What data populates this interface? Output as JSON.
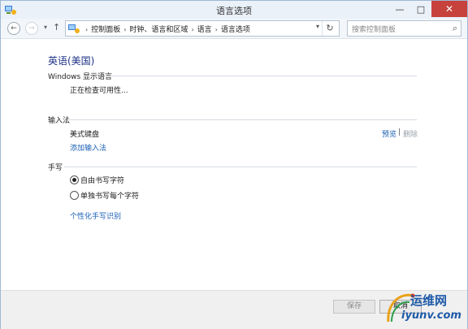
{
  "window": {
    "title": "语言选项",
    "minimize": "—",
    "maximize": "□",
    "close": "✕"
  },
  "nav": {
    "back": "←",
    "forward": "→",
    "history": "▾",
    "up": "↑",
    "breadcrumbs": [
      "控制面板",
      "时钟、语言和区域",
      "语言",
      "语言选项"
    ],
    "separator": "›",
    "dropdown": "▾",
    "refresh": "↻",
    "search_placeholder": "搜索控制面板",
    "search_icon": "⌕"
  },
  "content": {
    "language_title": "英语(美国)",
    "display_language": {
      "heading": "Windows 显示语言",
      "status": "正在检查可用性..."
    },
    "input_method": {
      "heading": "输入法",
      "items": [
        {
          "name": "美式键盘",
          "preview": "预览",
          "divider": "|",
          "remove": "删除"
        }
      ],
      "add_link": "添加输入法"
    },
    "handwriting": {
      "heading": "手写",
      "options": [
        {
          "label": "自由书写字符",
          "selected": true
        },
        {
          "label": "单独书写每个字符",
          "selected": false
        }
      ],
      "personalize_link": "个性化手写识别"
    }
  },
  "footer": {
    "save": "保存",
    "cancel": "取消"
  },
  "watermark": {
    "brand_cn": "运维网",
    "brand_url": "iyunv.com"
  }
}
